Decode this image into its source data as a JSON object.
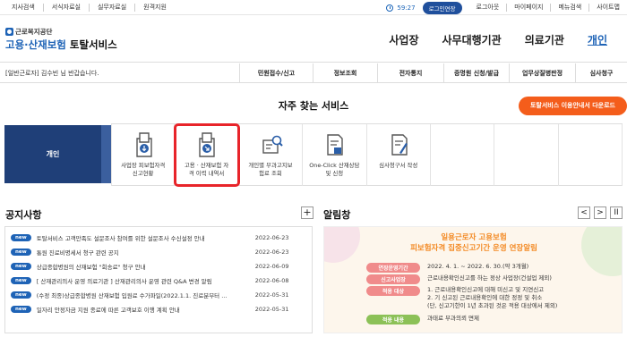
{
  "topbar": {
    "left_links": [
      "지사검색",
      "서식자료실",
      "실무자료실",
      "원격지원"
    ],
    "timer": "59:27",
    "extend_label": "로그인연장",
    "right_links": [
      "로그아웃",
      "마이페이지",
      "메뉴검색",
      "사이트맵"
    ]
  },
  "header": {
    "org_name": "근로복지공단",
    "service_part1": "고용·산재보험",
    "service_part2": " 토탈서비스",
    "nav": [
      "사업장",
      "사무대행기관",
      "의료기관",
      "개인"
    ]
  },
  "subbar": {
    "welcome": "[일반근로자] 김수빈 님 반갑습니다.",
    "menu": [
      "민원접수/신고",
      "정보조회",
      "전자통지",
      "증명원 신청/발급",
      "업무상질병판정",
      "심사청구"
    ]
  },
  "favorites": {
    "title": "자주 찾는 서비스",
    "guide_button": "토탈서비스 이용안내서 다운로드",
    "person_label": "개인",
    "services": [
      {
        "label": "사업장 피보험자격\n신고현황",
        "icon": "document-download-icon"
      },
      {
        "label": "고용 · 산재보험 자\n격 이력 내역서",
        "icon": "document-history-icon"
      },
      {
        "label": "개인별 부과고지보\n험료 조회",
        "icon": "card-search-icon"
      },
      {
        "label": "One-Click 산재상담\n및 신청",
        "icon": "document-stamp-icon"
      },
      {
        "label": "심사청구서 작성",
        "icon": "document-write-icon"
      },
      {
        "label": "",
        "icon": ""
      },
      {
        "label": "",
        "icon": ""
      },
      {
        "label": "",
        "icon": ""
      }
    ]
  },
  "notice": {
    "title": "공지사항",
    "more": "+",
    "badge": "new",
    "items": [
      {
        "text": "토탈서비스 고객만족도 설문조사 참여를 위한 설문조사 수신설정 안내",
        "date": "2022-06-23"
      },
      {
        "text": "통원 진료비명세서 청구 관련 공지",
        "date": "2022-06-23"
      },
      {
        "text": "상급종합병원의 산재보험 \"회송료\" 청구 안내",
        "date": "2022-06-09"
      },
      {
        "text": "[ 산재관리의사 운영 의료기관 ]  산재관리의사 운영 관련 Q&A 변경 알림",
        "date": "2022-06-08"
      },
      {
        "text": "(수정 최종)상급종합병원 산재보험 입원료 수가파일(2022.1.1. 진료분부터 ...",
        "date": "2022-05-31"
      },
      {
        "text": "일자리 안정자금 지원 종료에 따른 고객보호 이행 계획 안내",
        "date": "2022-05-31"
      }
    ]
  },
  "alert": {
    "title": "알림창",
    "prev": "<",
    "next": ">",
    "pause": "II",
    "headline1": "일용근로자 고용보험",
    "headline2": "피보험자격 집중신고기간 운영 연장알림",
    "rows": [
      {
        "label": "연장운영기간",
        "text": "2022. 4. 1. ~ 2022. 6. 30.(약 3개월)",
        "color": "#f08b8b"
      },
      {
        "label": "신고사업장",
        "text": "근로내용확인신고를 하는 정상 사업장(건설업 제외)",
        "color": "#f08b8b"
      },
      {
        "label": "적용 대상",
        "text": "1. 근로내용확인신고에 대해 미신고 및 지연신고\n2. 기 신고된 근로내용확인에 대한 정정 및 취소\n(단, 신고기한이 1년 초과된 것은 적용 대상에서 제외)",
        "color": "#f08b8b"
      },
      {
        "label": "적용 내용",
        "text": "과태료 부과의뢰 면제",
        "color": "#8cc157"
      }
    ]
  }
}
